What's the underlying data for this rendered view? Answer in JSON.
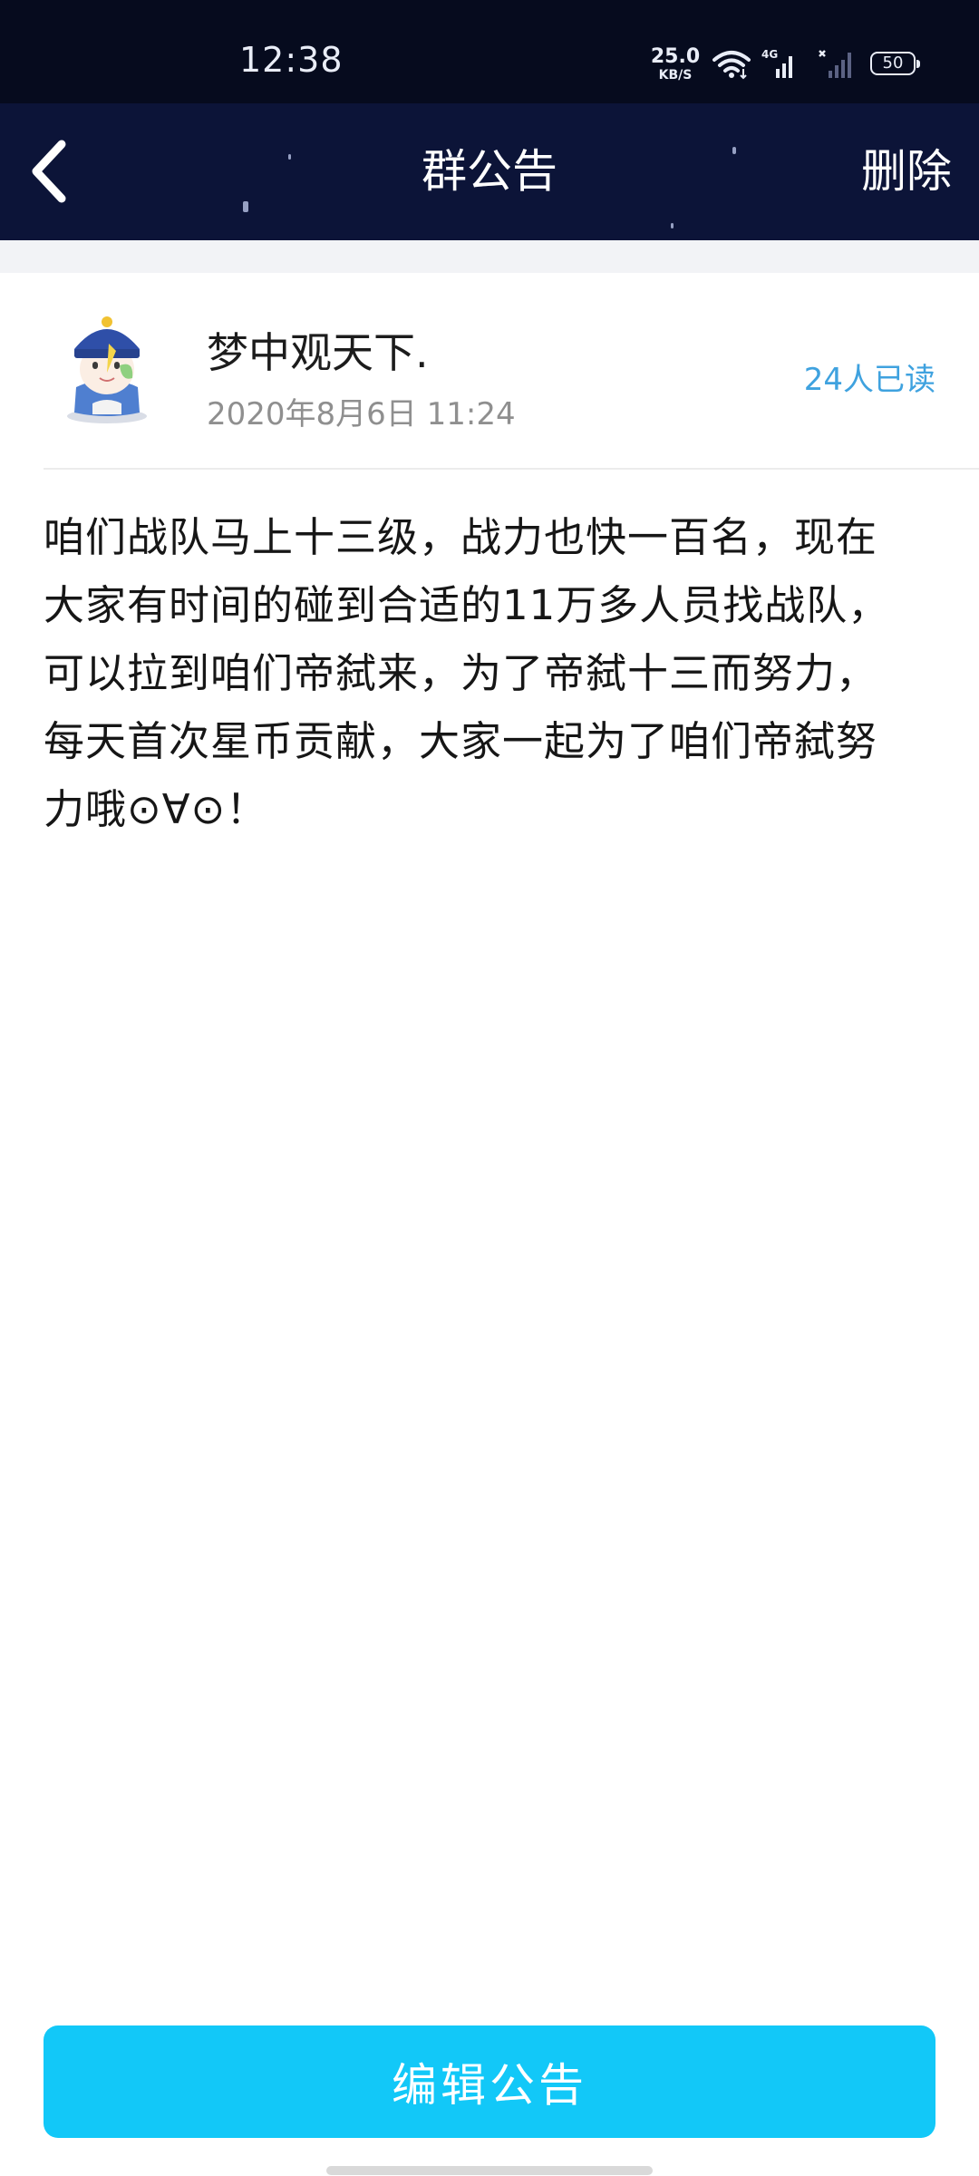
{
  "status_bar": {
    "time": "12:38",
    "net_speed_value": "25.0",
    "net_speed_unit": "KB/S",
    "network_type": "4G",
    "battery": "50"
  },
  "nav": {
    "title": "群公告",
    "action": "删除"
  },
  "announcement": {
    "author_name": "梦中观天下.",
    "date": "2020年8月6日 11:24",
    "read_count": "24人已读",
    "content": "咱们战队马上十三级，战力也快一百名，现在\n大家有时间的碰到合适的11万多人员找战队，\n可以拉到咱们帝弑来，为了帝弑十三而努力，\n每天首次星币贡献，大家一起为了咱们帝弑努\n力哦⊙∀⊙！"
  },
  "footer": {
    "edit_label": "编辑公告"
  },
  "colors": {
    "header_bg": "#0c1438",
    "status_bg": "#060b1e",
    "accent": "#12c8f8",
    "read_count": "#3fa2df"
  },
  "icons": [
    "back-arrow-icon",
    "wifi-icon",
    "signal-icon",
    "battery-icon"
  ]
}
